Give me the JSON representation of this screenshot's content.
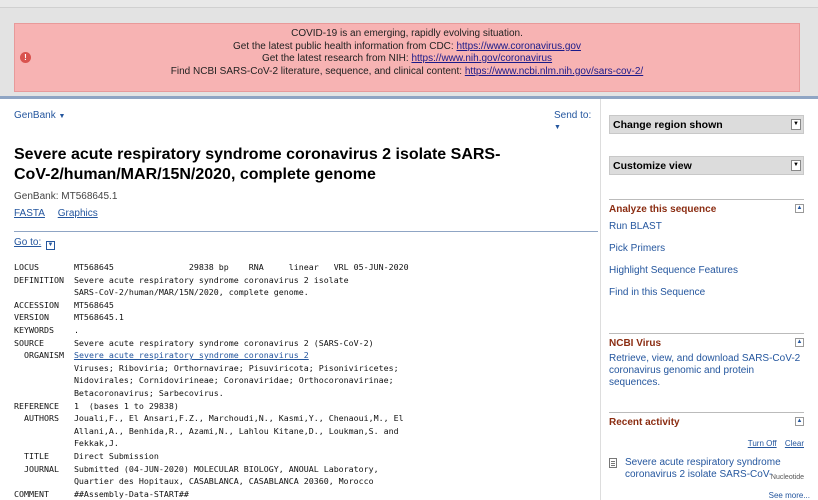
{
  "banner": {
    "line1": "COVID-19 is an emerging, rapidly evolving situation.",
    "line2_text": "Get the latest public health information from CDC: ",
    "line2_link": "https://www.coronavirus.gov",
    "line3_text": "Get the latest research from NIH: ",
    "line3_link": "https://www.nih.gov/coronavirus",
    "line4_text": "Find NCBI SARS-CoV-2 literature, sequence, and clinical content: ",
    "line4_link": "https://www.ncbi.nlm.nih.gov/sars-cov-2/"
  },
  "header": {
    "db_menu": "GenBank",
    "send_to": "Send to:"
  },
  "record": {
    "title": "Severe acute respiratory syndrome coronavirus 2 isolate SARS-CoV-2/human/MAR/15N/2020, complete genome",
    "accession_line": "GenBank: MT568645.1",
    "links": [
      "FASTA",
      "Graphics"
    ],
    "goto": "Go to:",
    "locus": "LOCUS       MT568645               29838 bp    RNA     linear   VRL 05-JUN-2020",
    "definition": "DEFINITION  Severe acute respiratory syndrome coronavirus 2 isolate\n            SARS-CoV-2/human/MAR/15N/2020, complete genome.",
    "accession": "ACCESSION   MT568645",
    "version": "VERSION     MT568645.1",
    "keywords": "KEYWORDS    .",
    "source": "SOURCE      Severe acute respiratory syndrome coronavirus 2 (SARS-CoV-2)",
    "organism_label": "  ORGANISM  ",
    "organism_link": "Severe acute respiratory syndrome coronavirus 2",
    "organism_taxonomy": "            Viruses; Riboviria; Orthornavirae; Pisuviricota; Pisoniviricetes;\n            Nidovirales; Cornidovirineae; Coronaviridae; Orthocoronavirinae;\n            Betacoronavirus; Sarbecovirus.",
    "reference": "REFERENCE   1  (bases 1 to 29838)",
    "authors": "  AUTHORS   Jouali,F., El Ansari,F.Z., Marchoudi,N., Kasmi,Y., Chenaoui,M., El\n            Allani,A., Benhida,R., Azami,N., Lahlou Kitane,D., Loukman,S. and\n            Fekkak,J.",
    "title_line": "  TITLE     Direct Submission",
    "journal": "  JOURNAL   Submitted (04-JUN-2020) MOLECULAR BIOLOGY, ANOUAL Laboratory,\n            Quartier des Hopitaux, CASABLANCA, CASABLANCA 20360, Morocco",
    "comment": "COMMENT     ##Assembly-Data-START##"
  },
  "sidebar": {
    "change_region": "Change region shown",
    "customize_view": "Customize view",
    "analyze_title": "Analyze this sequence",
    "analyze_links": [
      "Run BLAST",
      "Pick Primers",
      "Highlight Sequence Features",
      "Find in this Sequence"
    ],
    "virus_title": "NCBI Virus",
    "virus_text": "Retrieve, view, and download SARS-CoV-2 coronavirus genomic and protein sequences.",
    "recent_title": "Recent activity",
    "turn_off": "Turn Off",
    "clear": "Clear",
    "recent_item": "Severe acute respiratory syndrome coronavirus 2 isolate SARS-CoV-",
    "recent_item_type": "Nucleotide",
    "see_more": "See more..."
  }
}
